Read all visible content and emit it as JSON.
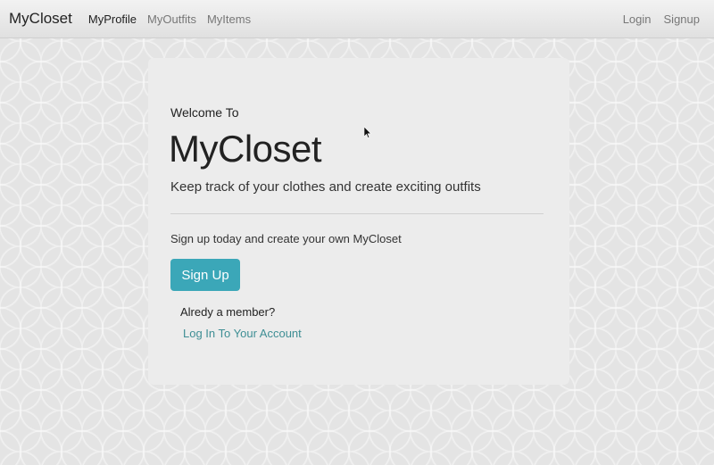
{
  "navbar": {
    "brand": "MyCloset",
    "links": [
      {
        "label": "MyProfile"
      },
      {
        "label": "MyOutfits"
      },
      {
        "label": "MyItems"
      }
    ],
    "right_links": [
      {
        "label": "Login"
      },
      {
        "label": "Signup"
      }
    ]
  },
  "hero": {
    "welcome": "Welcome To",
    "title": "MyCloset",
    "lead": "Keep track of your clothes and create exciting outfits",
    "signup_prompt": "Sign up today and create your own MyCloset",
    "signup_button": "Sign Up",
    "member_text": "Alredy a member?",
    "login_link": "Log In To Your Account"
  },
  "colors": {
    "accent": "#3ba7b8",
    "link": "#3e8e94"
  }
}
